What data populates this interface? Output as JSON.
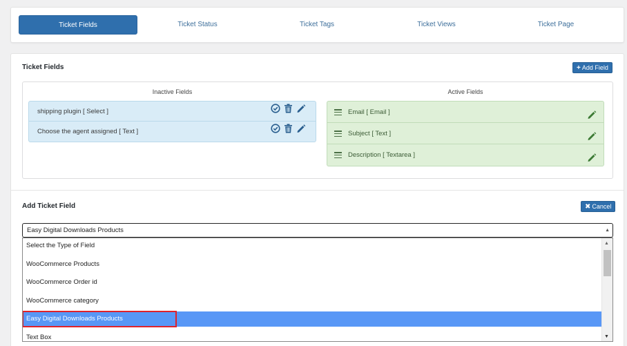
{
  "tabs": [
    {
      "label": "Ticket Fields",
      "active": true
    },
    {
      "label": "Ticket Status",
      "active": false
    },
    {
      "label": "Ticket Tags",
      "active": false
    },
    {
      "label": "Ticket Views",
      "active": false
    },
    {
      "label": "Ticket Page",
      "active": false
    }
  ],
  "ticket_fields": {
    "title": "Ticket Fields",
    "add_button": "Add Field",
    "add_icon": "plus-icon",
    "inactive_heading": "Inactive Fields",
    "active_heading": "Active Fields",
    "inactive_items": [
      {
        "label": "shipping plugin [ Select ]"
      },
      {
        "label": "Choose the agent assigned [ Text ]"
      }
    ],
    "active_items": [
      {
        "label": "Email [ Email ]"
      },
      {
        "label": "Subject [ Text ]"
      },
      {
        "label": "Description [ Textarea ]"
      }
    ]
  },
  "add_ticket_field": {
    "title": "Add Ticket Field",
    "cancel_button": "Cancel",
    "cancel_icon": "x-icon",
    "selected_value": "Easy Digital Downloads Products",
    "options": [
      {
        "label": "Select the Type of Field"
      },
      {
        "label": "WooCommerce Products"
      },
      {
        "label": "WooCommerce Order id"
      },
      {
        "label": "WooCommerce category"
      },
      {
        "label": "Easy Digital Downloads Products"
      },
      {
        "label": "Text Box"
      }
    ],
    "highlighted_index": 4
  },
  "colors": {
    "primary": "#2f6fad",
    "inactive_bg": "#d9ecf7",
    "active_bg": "#dff0d8",
    "active_text": "#3a5a34",
    "icon_blue": "#2a5f8f",
    "icon_green": "#3d7a35",
    "option_selected": "#5897f6",
    "highlight_border": "#e0222a"
  }
}
